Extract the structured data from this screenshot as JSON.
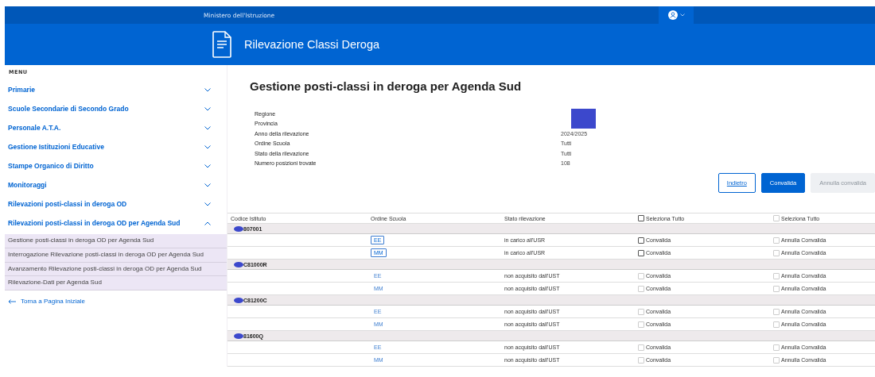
{
  "top_bar": {
    "ministry": "Ministero dell'Istruzione"
  },
  "header": {
    "title": "Rilevazione Classi Deroga"
  },
  "sidebar": {
    "menu_label": "MENU",
    "items": [
      {
        "label": "Primarie",
        "expanded": false
      },
      {
        "label": "Scuole Secondarie di Secondo Grado",
        "expanded": false
      },
      {
        "label": "Personale A.T.A.",
        "expanded": false
      },
      {
        "label": "Gestione Istituzioni Educative",
        "expanded": false
      },
      {
        "label": "Stampe Organico di Diritto",
        "expanded": false
      },
      {
        "label": "Monitoraggi",
        "expanded": false
      },
      {
        "label": "Rilevazioni posti-classi in deroga OD",
        "expanded": false
      },
      {
        "label": "Rilevazioni posti-classi in deroga OD per Agenda Sud",
        "expanded": true,
        "children": [
          {
            "label": "Gestione posti-classi in deroga OD per Agenda Sud"
          },
          {
            "label": "Interrogazione Rilevazione posti-classi in deroga OD per Agenda Sud"
          },
          {
            "label": "Avanzamento Rilevazione posti-classi in deroga OD per Agenda Sud"
          },
          {
            "label": "Rilevazione-Dati per Agenda Sud"
          }
        ]
      }
    ],
    "back_link": "Torna a Pagina Iniziale"
  },
  "page": {
    "title": "Gestione posti-classi in deroga per Agenda Sud",
    "info": [
      {
        "label": "Regione",
        "kind": "hidden"
      },
      {
        "label": "Provincia",
        "kind": "hidden"
      },
      {
        "label": "Anno della rilevazione",
        "kind": "text",
        "value": "2024/2025"
      },
      {
        "label": "Ordine Scuola",
        "kind": "text",
        "value": "Tutti"
      },
      {
        "label": "Stato della rilevazione",
        "kind": "text",
        "value": "Tutti"
      },
      {
        "label": "Numero posizioni trovate",
        "kind": "text",
        "value": "108"
      }
    ],
    "buttons": [
      {
        "label": "Indietro",
        "kind": "outline",
        "disabled": false
      },
      {
        "label": "Convalida",
        "kind": "primary",
        "disabled": false
      },
      {
        "label": "Annulla convalida",
        "kind": "primary",
        "disabled": true
      }
    ]
  },
  "table": {
    "columns": [
      {
        "label": "Codice Istituto",
        "kind": "text"
      },
      {
        "label": "Ordine Scuola",
        "kind": "text"
      },
      {
        "label": "Stato rilevazione",
        "kind": "text"
      },
      {
        "label": "Seleziona Tutto",
        "kind": "checkbox"
      },
      {
        "label": "Seleziona Tutto",
        "kind": "checkbox_disabled"
      }
    ],
    "groups": [
      {
        "code": "807001",
        "redacted": true,
        "rows": [
          {
            "ordine": "EE",
            "kind": "button",
            "stato": "in carico all'USR",
            "convalida": "Convalida",
            "convalida_disabled": false,
            "annulla": "Annulla Convalida",
            "annulla_disabled": true
          },
          {
            "ordine": "MM",
            "kind": "button",
            "stato": "in carico all'USR",
            "convalida": "Convalida",
            "convalida_disabled": false,
            "annulla": "Annulla Convalida",
            "annulla_disabled": true
          }
        ]
      },
      {
        "code": "C81000R",
        "redacted": true,
        "rows": [
          {
            "ordine": "EE",
            "kind": "link",
            "stato": "non acquisito dall'UST",
            "convalida": "Convalida",
            "convalida_disabled": true,
            "annulla": "Annulla Convalida",
            "annulla_disabled": true
          },
          {
            "ordine": "MM",
            "kind": "link",
            "stato": "non acquisito dall'UST",
            "convalida": "Convalida",
            "convalida_disabled": true,
            "annulla": "Annulla Convalida",
            "annulla_disabled": true
          }
        ]
      },
      {
        "code": "C81200C",
        "redacted": true,
        "rows": [
          {
            "ordine": "EE",
            "kind": "link",
            "stato": "non acquisito dall'UST",
            "convalida": "Convalida",
            "convalida_disabled": true,
            "annulla": "Annulla Convalida",
            "annulla_disabled": true
          },
          {
            "ordine": "MM",
            "kind": "link",
            "stato": "non acquisito dall'UST",
            "convalida": "Convalida",
            "convalida_disabled": true,
            "annulla": "Annulla Convalida",
            "annulla_disabled": true
          }
        ]
      },
      {
        "code": "81600Q",
        "redacted": true,
        "rows": [
          {
            "ordine": "EE",
            "kind": "link",
            "stato": "non acquisito dall'UST",
            "convalida": "Convalida",
            "convalida_disabled": true,
            "annulla": "Annulla Convalida",
            "annulla_disabled": true
          },
          {
            "ordine": "MM",
            "kind": "link",
            "stato": "non acquisito dall'UST",
            "convalida": "Convalida",
            "convalida_disabled": true,
            "annulla": "Annulla Convalida",
            "annulla_disabled": true
          }
        ]
      }
    ]
  }
}
